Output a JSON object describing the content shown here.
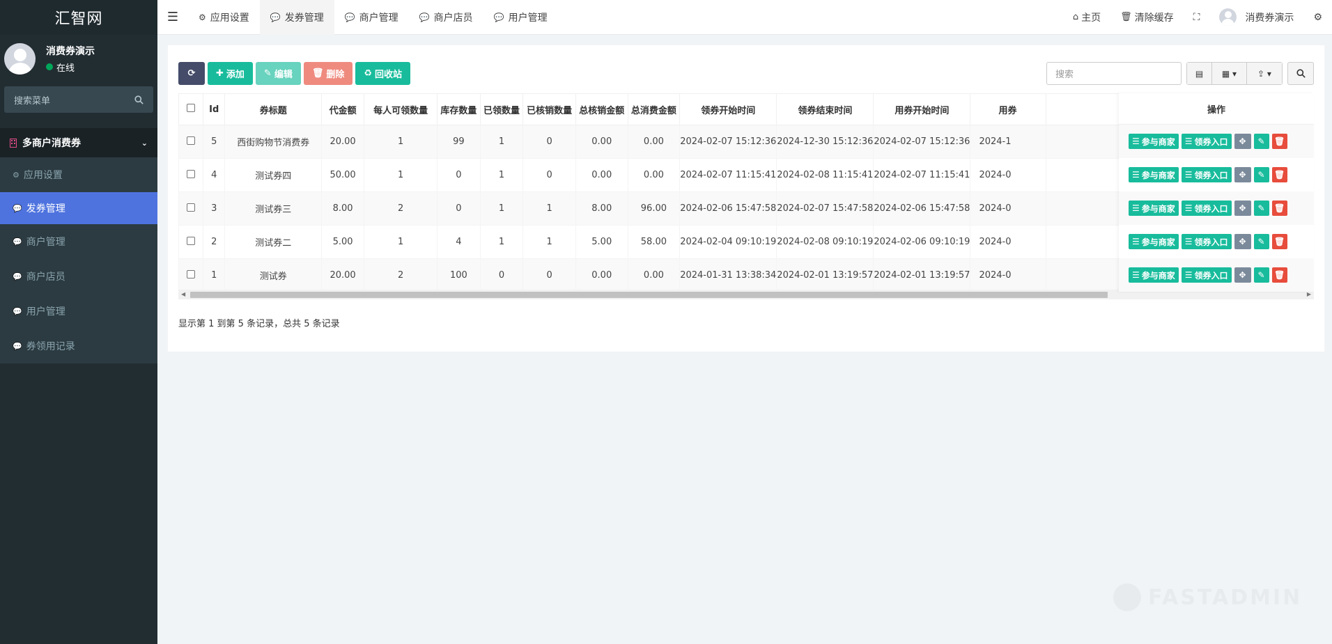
{
  "sidebar": {
    "brand": "汇智网",
    "user": {
      "name": "消费券演示",
      "status": "在线"
    },
    "search_placeholder": "搜索菜单",
    "group": "多商户消费券",
    "items": [
      {
        "label": "应用设置",
        "icon": "gear-icon"
      },
      {
        "label": "发券管理",
        "icon": "comment-icon"
      },
      {
        "label": "商户管理",
        "icon": "comment-icon"
      },
      {
        "label": "商户店员",
        "icon": "comment-icon"
      },
      {
        "label": "用户管理",
        "icon": "comment-icon"
      },
      {
        "label": "券领用记录",
        "icon": "comment-icon"
      }
    ]
  },
  "topnav": {
    "tabs": [
      {
        "label": "应用设置",
        "icon": "gear-icon"
      },
      {
        "label": "发券管理",
        "icon": "comment-icon"
      },
      {
        "label": "商户管理",
        "icon": "comment-icon"
      },
      {
        "label": "商户店员",
        "icon": "comment-icon"
      },
      {
        "label": "用户管理",
        "icon": "comment-icon"
      }
    ],
    "home": "主页",
    "clear_cache": "清除缓存",
    "user": "消费券演示"
  },
  "toolbar": {
    "add": "添加",
    "edit": "编辑",
    "delete": "删除",
    "recycle": "回收站",
    "search_placeholder": "搜索"
  },
  "table": {
    "headers": [
      "Id",
      "券标题",
      "代金额",
      "每人可领数量",
      "库存数量",
      "已领数量",
      "已核销数量",
      "总核销金额",
      "总消费金额",
      "领券开始时间",
      "领券结束时间",
      "用券开始时间",
      "用券"
    ],
    "ops_header": "操作",
    "rows": [
      {
        "id": "5",
        "title": "西街购物节消费券",
        "amount": "20.00",
        "per": "1",
        "stock": "99",
        "got": "1",
        "used": "0",
        "used_amt": "0.00",
        "spent": "0.00",
        "get_start": "2024-02-07 15:12:36",
        "get_end": "2024-12-30 15:12:36",
        "use_start": "2024-02-07 15:12:36",
        "use_end": "2024-1"
      },
      {
        "id": "4",
        "title": "测试券四",
        "amount": "50.00",
        "per": "1",
        "stock": "0",
        "got": "1",
        "used": "0",
        "used_amt": "0.00",
        "spent": "0.00",
        "get_start": "2024-02-07 11:15:41",
        "get_end": "2024-02-08 11:15:41",
        "use_start": "2024-02-07 11:15:41",
        "use_end": "2024-0"
      },
      {
        "id": "3",
        "title": "测试券三",
        "amount": "8.00",
        "per": "2",
        "stock": "0",
        "got": "1",
        "used": "1",
        "used_amt": "8.00",
        "spent": "96.00",
        "get_start": "2024-02-06 15:47:58",
        "get_end": "2024-02-07 15:47:58",
        "use_start": "2024-02-06 15:47:58",
        "use_end": "2024-0"
      },
      {
        "id": "2",
        "title": "测试券二",
        "amount": "5.00",
        "per": "1",
        "stock": "4",
        "got": "1",
        "used": "1",
        "used_amt": "5.00",
        "spent": "58.00",
        "get_start": "2024-02-04 09:10:19",
        "get_end": "2024-02-08 09:10:19",
        "use_start": "2024-02-06 09:10:19",
        "use_end": "2024-0"
      },
      {
        "id": "1",
        "title": "测试券",
        "amount": "20.00",
        "per": "2",
        "stock": "100",
        "got": "0",
        "used": "0",
        "used_amt": "0.00",
        "spent": "0.00",
        "get_start": "2024-01-31 13:38:34",
        "get_end": "2024-02-01 13:19:57",
        "use_start": "2024-02-01 13:19:57",
        "use_end": "2024-0"
      }
    ],
    "op_join": "参与商家",
    "op_entry": "领券入口"
  },
  "footer": "显示第 1 到第 5 条记录，总共 5 条记录",
  "watermark": "FASTADMIN",
  "colors": {
    "sidebar_bg": "#222d32",
    "active": "#4e73df",
    "success": "#18bc9c",
    "danger": "#e74c3c"
  }
}
